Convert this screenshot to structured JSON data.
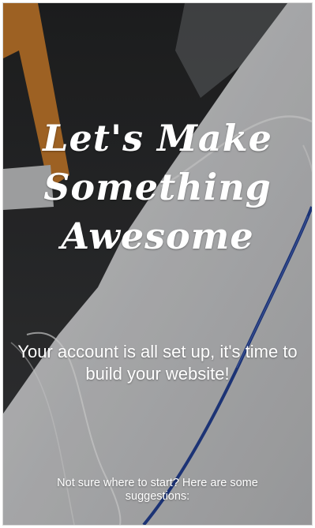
{
  "welcome": {
    "headline_lines": [
      "Let's Make",
      "Something",
      "Awesome"
    ],
    "subtitle": "Your account is all set up, it's time to build your website!",
    "hint": "Not sure where to start? Here are some suggestions:"
  },
  "colors": {
    "text": "#ffffff",
    "background_dark": "#2a2b2d",
    "orange_strip": "#c0772b",
    "laptop_surface": "#cfd0d2",
    "blue_edge": "#233f8f"
  }
}
